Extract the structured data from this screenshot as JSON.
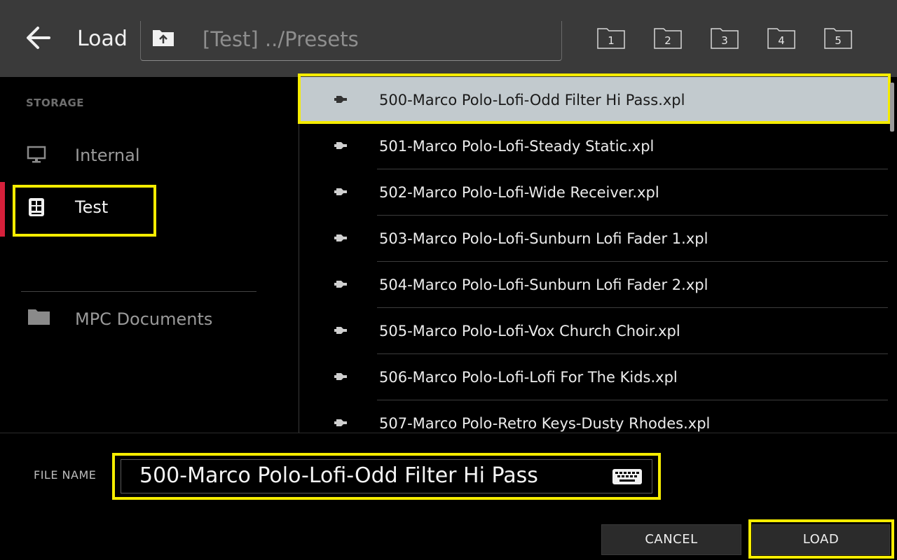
{
  "header": {
    "title": "Load",
    "path": "[Test] ../Presets",
    "slots": [
      "1",
      "2",
      "3",
      "4",
      "5"
    ]
  },
  "sidebar": {
    "section_label": "STORAGE",
    "items": [
      {
        "label": "Internal",
        "icon": "monitor-icon",
        "active": false
      },
      {
        "label": "Test",
        "icon": "usb-drive-icon",
        "active": true
      },
      {
        "label": "MPC Documents",
        "icon": "folder-icon",
        "active": false
      }
    ]
  },
  "files": [
    {
      "name": "500-Marco Polo-Lofi-Odd Filter Hi Pass.xpl",
      "selected": true
    },
    {
      "name": "501-Marco Polo-Lofi-Steady Static.xpl",
      "selected": false
    },
    {
      "name": "502-Marco Polo-Lofi-Wide Receiver.xpl",
      "selected": false
    },
    {
      "name": "503-Marco Polo-Lofi-Sunburn Lofi Fader 1.xpl",
      "selected": false
    },
    {
      "name": "504-Marco Polo-Lofi-Sunburn Lofi Fader 2.xpl",
      "selected": false
    },
    {
      "name": "505-Marco Polo-Lofi-Vox Church Choir.xpl",
      "selected": false
    },
    {
      "name": "506-Marco Polo-Lofi-Lofi For The Kids.xpl",
      "selected": false
    },
    {
      "name": "507-Marco Polo-Retro Keys-Dusty Rhodes.xpl",
      "selected": false
    }
  ],
  "footer": {
    "file_name_label": "FILE NAME",
    "file_name_value": "500-Marco Polo-Lofi-Odd Filter Hi Pass",
    "cancel_label": "CANCEL",
    "load_label": "LOAD"
  },
  "colors": {
    "header_bg": "#3a3a3a",
    "highlight": "#f5ec00",
    "active_marker": "#d6203b",
    "selected_row": "#c2cace"
  }
}
